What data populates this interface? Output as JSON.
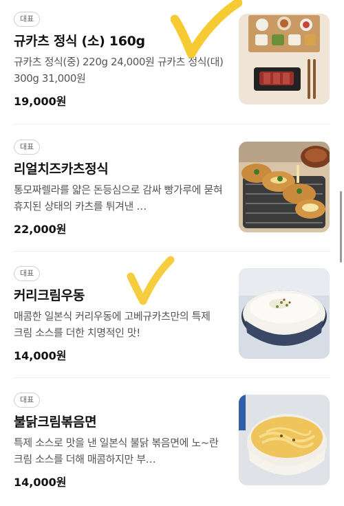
{
  "menu": {
    "items": [
      {
        "badge": "대표",
        "name": "규카츠 정식 (소) 160g",
        "description": "규카츠 정식(중) 220g 24,000원 규카츠 정식(대) 300g 31,000원",
        "price": "19,000원"
      },
      {
        "badge": "대표",
        "name": "리얼치즈카츠정식",
        "description": "통모짜렐라를 얇은 돈등심으로 감싸 빵가루에 묻혀 휴지된 상태의 카츠를 튀겨낸 …",
        "price": "22,000원"
      },
      {
        "badge": "대표",
        "name": "커리크림우동",
        "description": "매콤한 일본식 커리우동에 고베규카츠만의 특제 크림 소스를 더한 치명적인 맛!",
        "price": "14,000원"
      },
      {
        "badge": "대표",
        "name": "불닭크림볶음면",
        "description": "특제 소스로 맛을 낸 일본식 불닭 볶음면에 노~란 크림 소스를 더해 매콤하지만 부…",
        "price": "14,000원"
      }
    ]
  },
  "colors": {
    "check_mark": "#f4c41c",
    "badge_border": "#cfcfcf",
    "description_text": "#555555"
  }
}
